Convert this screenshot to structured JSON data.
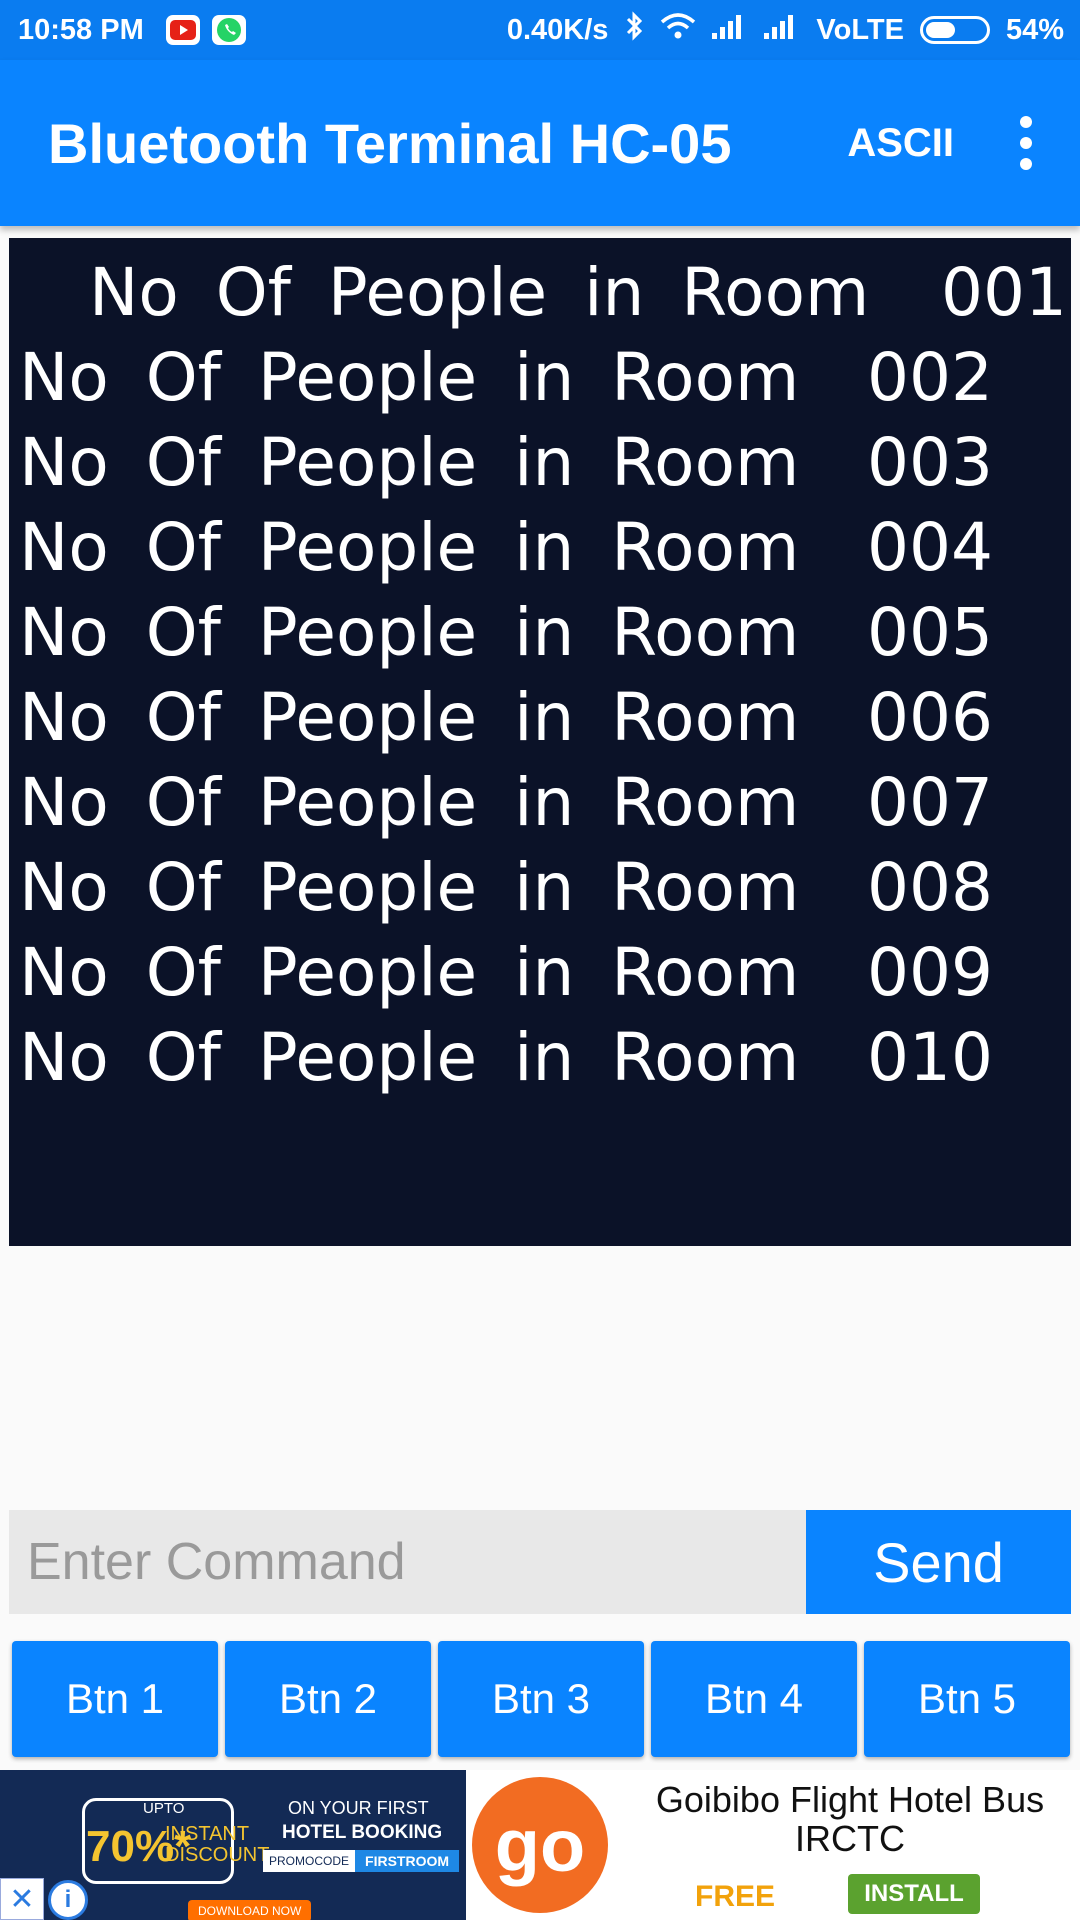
{
  "status_bar": {
    "time": "10:58 PM",
    "speed": "0.40K/s",
    "network": "VoLTE",
    "battery": "54%",
    "battery_level": 0.54,
    "icons": [
      "youtube-icon",
      "whatsapp-icon",
      "bluetooth-icon",
      "wifi-icon",
      "signal-icon",
      "signal-icon",
      "battery-icon"
    ]
  },
  "appbar": {
    "title": "Bluetooth Terminal HC-05",
    "mode": "ASCII",
    "overflow_icon": "more-vert-icon"
  },
  "terminal": {
    "lines": [
      {
        "text": "No Of People in Room",
        "value": "001"
      },
      {
        "text": "No Of People in Room",
        "value": "002"
      },
      {
        "text": "No Of People in Room",
        "value": "003"
      },
      {
        "text": "No Of People in Room",
        "value": "004"
      },
      {
        "text": "No Of People in Room",
        "value": "005"
      },
      {
        "text": "No Of People in Room",
        "value": "006"
      },
      {
        "text": "No Of People in Room",
        "value": "007"
      },
      {
        "text": "No Of People in Room",
        "value": "008"
      },
      {
        "text": "No Of People in Room",
        "value": "009"
      },
      {
        "text": "No Of People in Room",
        "value": "010"
      }
    ]
  },
  "command": {
    "placeholder": "Enter Command",
    "value": "",
    "send_label": "Send"
  },
  "buttons": [
    "Btn 1",
    "Btn 2",
    "Btn 3",
    "Btn 4",
    "Btn 5"
  ],
  "ad": {
    "upto": "UPTO",
    "percent": "70%*",
    "instant": "INSTANT",
    "discount": "DISCOUNT",
    "on_first": "ON YOUR FIRST",
    "hotel_booking": "HOTEL BOOKING",
    "promocode": "PROMOCODE",
    "code": "FIRSTROOM",
    "download": "DOWNLOAD NOW",
    "logo": "go",
    "title": "Goibibo Flight Hotel Bus IRCTC",
    "price": "FREE",
    "install": "INSTALL"
  },
  "colors": {
    "primary": "#0a84ff",
    "status_bar": "#0a7cf0",
    "terminal_bg": "#0b1228",
    "ad_logo": "#f26c22",
    "install": "#5ba22f",
    "free": "#f2a20b"
  }
}
